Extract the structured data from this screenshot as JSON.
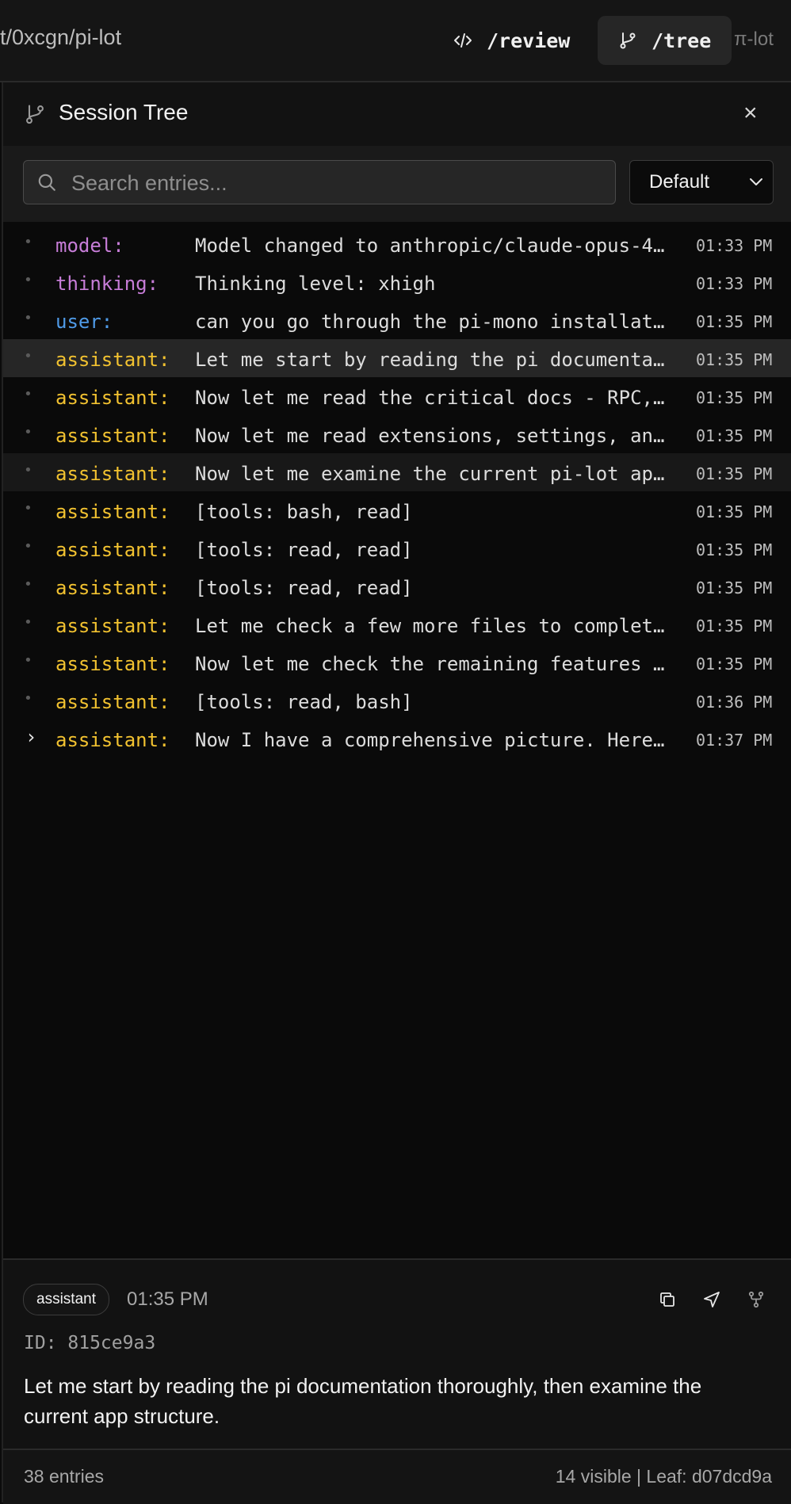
{
  "topbar": {
    "repo_path": "t/0xcgn/pi-lot",
    "review_label": "/review",
    "tree_label": "/tree",
    "brand": "π-lot"
  },
  "panel": {
    "title": "Session Tree",
    "close_glyph": "×",
    "search_placeholder": "Search entries...",
    "filter_value": "Default"
  },
  "entries": [
    {
      "role": "model:",
      "kind": "model",
      "text": "Model changed to anthropic/claude-opus-4…",
      "time": "01:33 PM"
    },
    {
      "role": "thinking:",
      "kind": "thinking",
      "text": "Thinking level: xhigh",
      "time": "01:33 PM"
    },
    {
      "role": "user:",
      "kind": "user",
      "text": "can you go through the pi-mono installat…",
      "time": "01:35 PM"
    },
    {
      "role": "assistant:",
      "kind": "assistant",
      "text": "Let me start by reading the pi documenta…",
      "time": "01:35 PM",
      "selected": true
    },
    {
      "role": "assistant:",
      "kind": "assistant",
      "text": "Now let me read the critical docs - RPC,…",
      "time": "01:35 PM"
    },
    {
      "role": "assistant:",
      "kind": "assistant",
      "text": "Now let me read extensions, settings, an…",
      "time": "01:35 PM"
    },
    {
      "role": "assistant:",
      "kind": "assistant",
      "text": "Now let me examine the current pi-lot ap…",
      "time": "01:35 PM",
      "hover": true
    },
    {
      "role": "assistant:",
      "kind": "assistant",
      "text": "[tools: bash, read]",
      "time": "01:35 PM"
    },
    {
      "role": "assistant:",
      "kind": "assistant",
      "text": "[tools: read, read]",
      "time": "01:35 PM"
    },
    {
      "role": "assistant:",
      "kind": "assistant",
      "text": "[tools: read, read]",
      "time": "01:35 PM"
    },
    {
      "role": "assistant:",
      "kind": "assistant",
      "text": "Let me check a few more files to complet…",
      "time": "01:35 PM"
    },
    {
      "role": "assistant:",
      "kind": "assistant",
      "text": "Now let me check the remaining features …",
      "time": "01:35 PM"
    },
    {
      "role": "assistant:",
      "kind": "assistant",
      "text": "[tools: read, bash]",
      "time": "01:36 PM"
    },
    {
      "role": "assistant:",
      "kind": "assistant",
      "text": "Now I have a comprehensive picture. Here…",
      "time": "01:37 PM",
      "expand": true
    }
  ],
  "detail": {
    "badge": "assistant",
    "time": "01:35 PM",
    "id": "ID: 815ce9a3",
    "text": "Let me start by reading the pi documentation thoroughly, then examine the current app structure."
  },
  "footer": {
    "count": "38 entries",
    "status": "14 visible | Leaf: d07dcd9a"
  },
  "icons": {
    "review": "code-icon",
    "tree": "git-branch-icon",
    "search": "search-icon",
    "copy": "copy-icon",
    "send": "send-icon",
    "fork": "fork-icon"
  }
}
